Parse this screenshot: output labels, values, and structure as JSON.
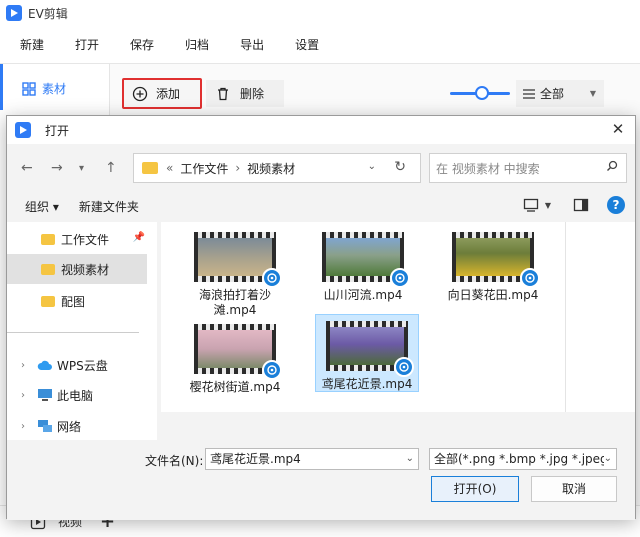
{
  "app": {
    "title": "EV剪辑",
    "menu": [
      "新建",
      "打开",
      "保存",
      "归档",
      "导出",
      "设置"
    ],
    "sidebar_item": "素材",
    "add_label": "添加",
    "delete_label": "删除",
    "filter_label": "全部",
    "bottom_label": "视频",
    "accent_color": "#2f7bf5"
  },
  "dialog": {
    "title": "打开",
    "breadcrumb": [
      "工作文件",
      "视频素材"
    ],
    "search_placeholder": "在 视频素材 中搜索",
    "toolbar": {
      "organize": "组织",
      "new_folder": "新建文件夹"
    },
    "nav": {
      "quick": [
        {
          "label": "工作文件",
          "pinned": true
        },
        {
          "label": "视频素材",
          "selected": true
        },
        {
          "label": "配图"
        }
      ],
      "locations": [
        {
          "label": "WPS云盘",
          "icon": "cloud-icon"
        },
        {
          "label": "此电脑",
          "icon": "computer-icon"
        },
        {
          "label": "网络",
          "icon": "network-icon"
        }
      ]
    },
    "files": [
      {
        "name": "海浪拍打着沙滩.mp4",
        "colors": [
          "#6d7f8f",
          "#c9b48a"
        ]
      },
      {
        "name": "山川河流.mp4",
        "colors": [
          "#5b86b8",
          "#4f7a3a"
        ]
      },
      {
        "name": "向日葵花田.mp4",
        "colors": [
          "#6c7d3a",
          "#d7b52c"
        ]
      },
      {
        "name": "樱花树街道.mp4",
        "colors": [
          "#d9a7b7",
          "#7d8a6a"
        ]
      },
      {
        "name": "鸢尾花近景.mp4",
        "colors": [
          "#6c5aa6",
          "#4d6a3a"
        ],
        "selected": true
      }
    ],
    "file_name_label": "文件名(N):",
    "file_name_value": "鸢尾花近景.mp4",
    "file_type_value": "全部(*.png *.bmp *.jpg *.jpeg",
    "open_label": "打开(O)",
    "cancel_label": "取消"
  }
}
